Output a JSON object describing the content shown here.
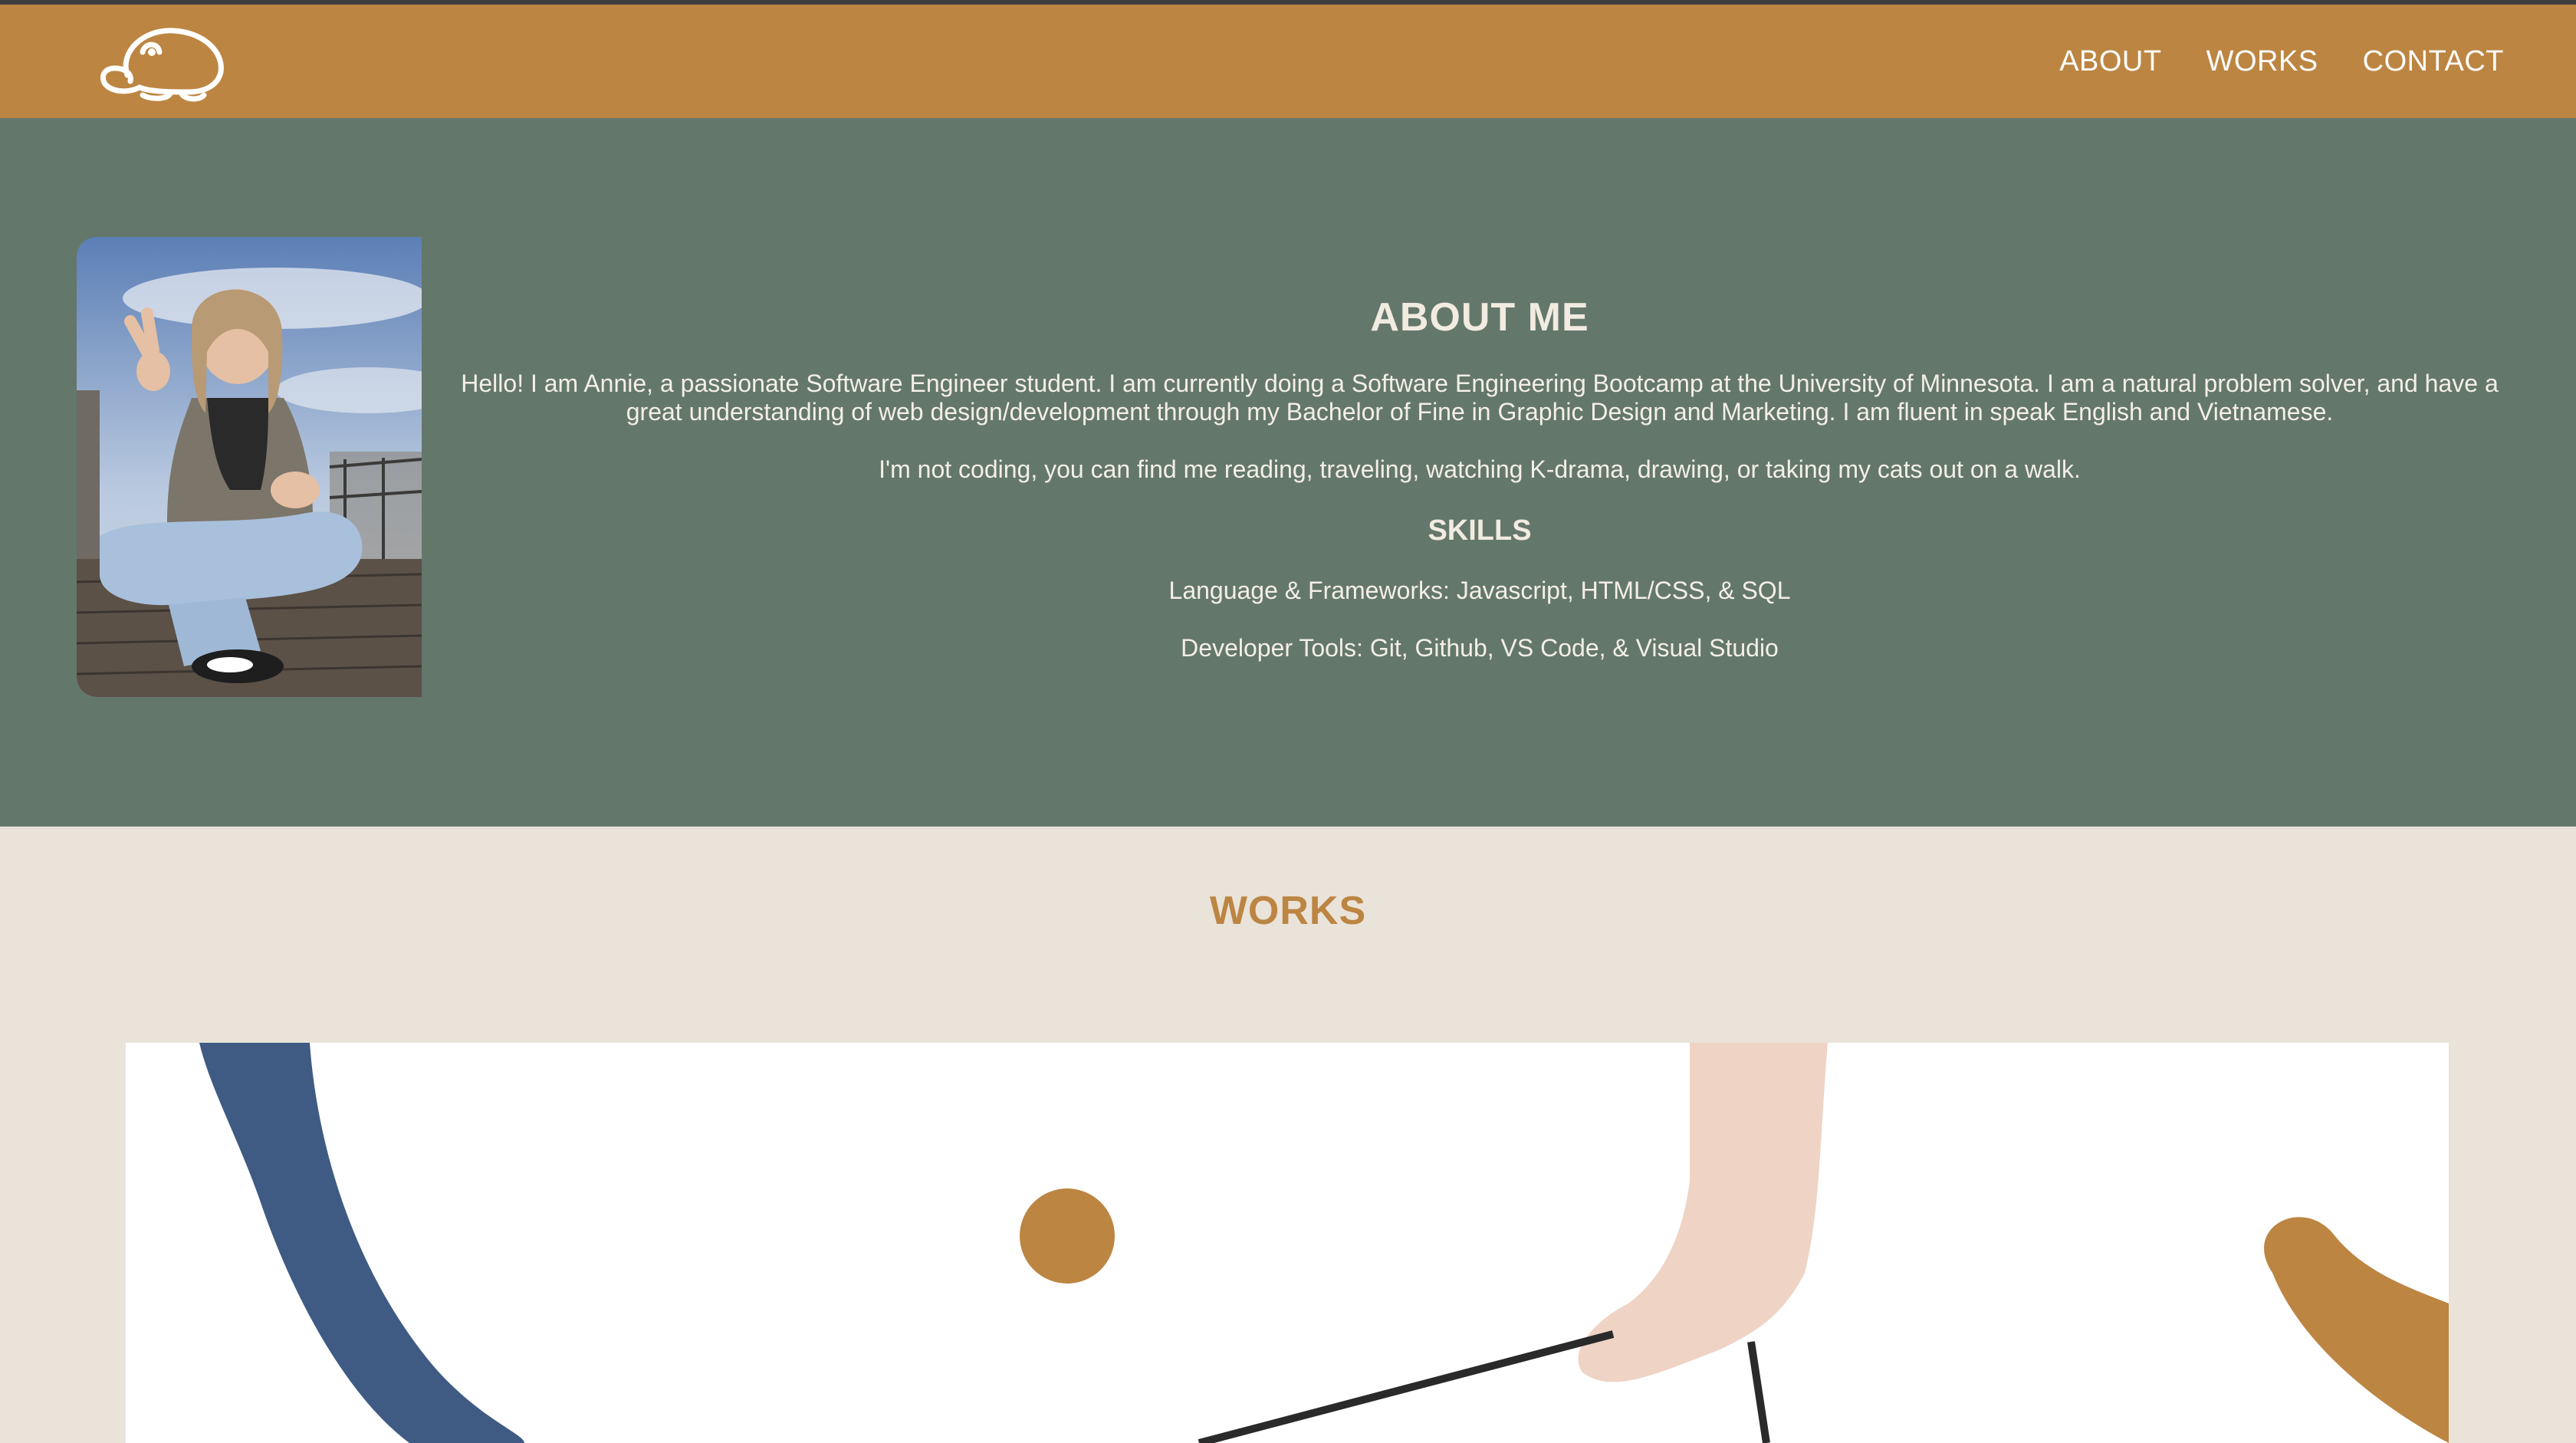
{
  "header": {
    "logo_icon": "frog-logo-icon",
    "nav": [
      {
        "label": "ABOUT"
      },
      {
        "label": "WORKS"
      },
      {
        "label": "CONTACT"
      }
    ],
    "colors": {
      "bar": "#bc8542",
      "text": "#ffffff"
    }
  },
  "about": {
    "title": "ABOUT ME",
    "bio": "Hello! I am Annie, a passionate Software Engineer student. I am currently doing a Software Engineering Bootcamp at the University of Minnesota. I am a natural problem solver, and have a great understanding of web design/development through my Bachelor of Fine in Graphic Design and Marketing. I am fluent in speak English and Vietnamese.",
    "hobbies": "I'm not coding, you can find me reading, traveling, watching K-drama, drawing, or taking my cats out on a walk.",
    "skills_title": "SKILLS",
    "skills": [
      "Language & Frameworks: Javascript, HTML/CSS, & SQL",
      "Developer Tools: Git, Github, VS Code, & Visual Studio"
    ],
    "background_color": "#64776b"
  },
  "works": {
    "title": "WORKS",
    "title_color": "#bc8542",
    "background_color": "#e9e3d9"
  }
}
